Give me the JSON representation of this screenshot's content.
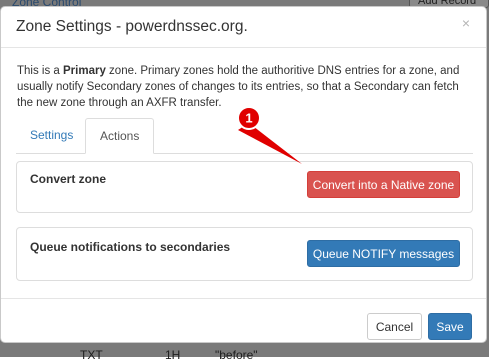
{
  "background": {
    "top_link": "Zone Control",
    "top_button": "Add Record",
    "row": [
      "TXT",
      "1H",
      "\"before\""
    ]
  },
  "modal": {
    "title": "Zone Settings - powerdnssec.org.",
    "close_glyph": "×",
    "intro": {
      "part1": "This is a ",
      "bold": "Primary",
      "part2": " zone. Primary zones hold the authoritive DNS entries for a zone, and usually notify Secondary zones of changes to its entries, so that a Secondary can fetch the new zone through an AXFR transfer."
    },
    "tabs": [
      {
        "label": "Settings",
        "active": false
      },
      {
        "label": "Actions",
        "active": true
      }
    ],
    "actions": {
      "convert": {
        "label": "Convert zone",
        "button": "Convert into a Native zone"
      },
      "notify": {
        "label": "Queue notifications to secondaries",
        "button": "Queue NOTIFY messages"
      }
    },
    "footer": {
      "cancel": "Cancel",
      "save": "Save"
    }
  },
  "annotation": {
    "number": "1",
    "color": "#e00000"
  },
  "colors": {
    "primary": "#337ab7",
    "danger": "#d9534f",
    "overlay": "#7a7a7a"
  }
}
